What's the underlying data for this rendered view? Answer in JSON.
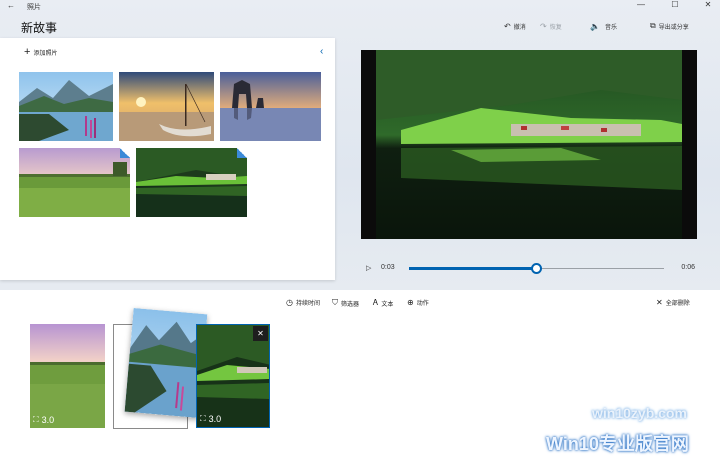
{
  "window": {
    "back_glyph": "←",
    "app_name": "照片",
    "minimize": "—",
    "maximize": "☐",
    "close": "✕"
  },
  "page": {
    "title": "新故事"
  },
  "toolbar": {
    "undo": "撤消",
    "redo": "恢复",
    "music": "音乐",
    "export": "导出或分享"
  },
  "library": {
    "add_label": "添加照片",
    "collapse_glyph": "‹",
    "photos": [
      {
        "name": "lake-mountains-flowers"
      },
      {
        "name": "boat-sunset-beach"
      },
      {
        "name": "rock-arch-sea"
      },
      {
        "name": "green-field-sky"
      },
      {
        "name": "green-valley-village"
      }
    ]
  },
  "player": {
    "current_time": "0:03",
    "duration": "0:06",
    "progress": 0.5
  },
  "storyboard": {
    "toolbar": {
      "duration": "持续时间",
      "filters": "筛选器",
      "text": "文本",
      "motion": "动作",
      "remove_all": "全部删除"
    },
    "cards": [
      {
        "name": "green-field",
        "duration": "3.0"
      },
      {
        "name": "lake-mountains-drag"
      },
      {
        "name": "green-valley-selected",
        "duration": "3.0"
      }
    ]
  },
  "watermark": {
    "line1": "win10zyb.com",
    "line2": "Win10专业版官网"
  },
  "colors": {
    "accent": "#0063b1"
  }
}
